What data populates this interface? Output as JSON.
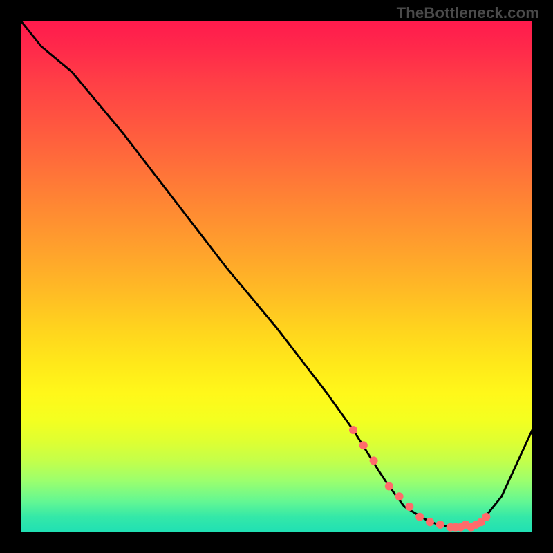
{
  "watermark": "TheBottleneck.com",
  "chart_data": {
    "type": "line",
    "title": "",
    "xlabel": "",
    "ylabel": "",
    "xlim": [
      0,
      100
    ],
    "ylim": [
      0,
      100
    ],
    "background_gradient": {
      "top": "#ff1a4d",
      "mid": "#ffe81a",
      "bottom": "#20e0b4"
    },
    "series": [
      {
        "name": "curve",
        "color": "#000000",
        "x": [
          0,
          4,
          10,
          20,
          30,
          40,
          50,
          60,
          65,
          70,
          72,
          75,
          80,
          84,
          88,
          90,
          94,
          100
        ],
        "values": [
          100,
          95,
          90,
          78,
          65,
          52,
          40,
          27,
          20,
          12,
          9,
          5,
          2,
          1,
          1,
          2,
          7,
          20
        ]
      }
    ],
    "markers": {
      "name": "dots",
      "color": "#ff6b6b",
      "radius": 6,
      "x": [
        65,
        67,
        69,
        72,
        74,
        76,
        78,
        80,
        82,
        84,
        85,
        86,
        87,
        88,
        89,
        90,
        91
      ],
      "values": [
        20,
        17,
        14,
        9,
        7,
        5,
        3,
        2,
        1.5,
        1,
        1,
        1,
        1.5,
        1,
        1.5,
        2,
        3
      ]
    }
  }
}
